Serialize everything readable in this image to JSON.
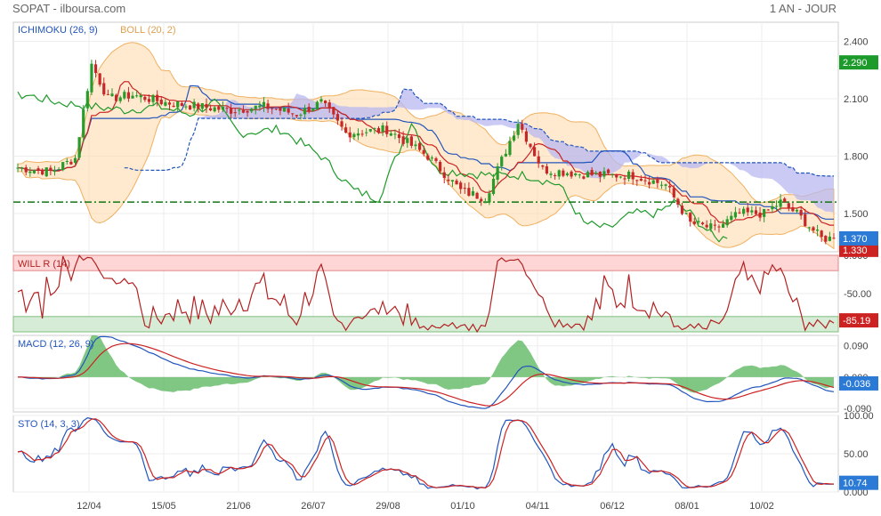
{
  "header": {
    "left_title": "SOPAT - ilboursa.com",
    "right_title": "1 AN - JOUR"
  },
  "colors": {
    "accent_green": "#1f9a2b",
    "accent_blue": "#2255bb",
    "accent_red": "#cc2222",
    "cloud": "#b8b8f0",
    "band": "#ffd9a8",
    "hist": "#4caf50"
  },
  "chart_data": [
    {
      "type": "candlestick",
      "panel": "price",
      "labels": {
        "ichimoku": "ICHIMOKU (26, 9)",
        "boll": "BOLL (20, 2)"
      },
      "x_ticks": [
        "12/04",
        "15/05",
        "21/06",
        "26/07",
        "29/08",
        "01/10",
        "04/11",
        "06/12",
        "08/01",
        "10/02"
      ],
      "y_ticks": [
        "2.400",
        "2.100",
        "1.800",
        "1.500"
      ],
      "ylim": [
        1.3,
        2.5
      ],
      "badges": {
        "high": "2.290",
        "last": "1.370",
        "partial": "1.330"
      },
      "reference_line": 1.56,
      "close_keypoints": [
        [
          0,
          1.74
        ],
        [
          8,
          1.72
        ],
        [
          14,
          1.79
        ],
        [
          18,
          2.28
        ],
        [
          22,
          2.1
        ],
        [
          28,
          2.12
        ],
        [
          36,
          2.08
        ],
        [
          44,
          2.06
        ],
        [
          52,
          2.04
        ],
        [
          60,
          2.06
        ],
        [
          68,
          2.02
        ],
        [
          74,
          2.08
        ],
        [
          80,
          1.92
        ],
        [
          90,
          1.94
        ],
        [
          100,
          1.8
        ],
        [
          108,
          1.62
        ],
        [
          114,
          1.58
        ],
        [
          122,
          1.98
        ],
        [
          128,
          1.73
        ],
        [
          136,
          1.71
        ],
        [
          142,
          1.7
        ],
        [
          150,
          1.7
        ],
        [
          158,
          1.65
        ],
        [
          164,
          1.45
        ],
        [
          170,
          1.42
        ],
        [
          176,
          1.5
        ],
        [
          182,
          1.5
        ],
        [
          186,
          1.56
        ],
        [
          190,
          1.5
        ],
        [
          196,
          1.37
        ]
      ]
    },
    {
      "type": "line",
      "panel": "willr",
      "label": "WILL R (14)",
      "y_ticks": [
        "0.000",
        "-50.00"
      ],
      "ylim": [
        -100,
        0
      ],
      "overbought": -20,
      "oversold": -80,
      "last_value": "-85.19"
    },
    {
      "type": "line",
      "panel": "macd",
      "label": "MACD (12, 26, 9)",
      "y_ticks": [
        "0.090",
        "0.000",
        "-0.090"
      ],
      "ylim": [
        -0.1,
        0.12
      ],
      "last_value": "-0.036"
    },
    {
      "type": "line",
      "panel": "sto",
      "label": "STO (14, 3, 3)",
      "y_ticks": [
        "100.00",
        "50.00",
        "0.000"
      ],
      "ylim": [
        0,
        100
      ],
      "last_value": "10.74"
    }
  ]
}
